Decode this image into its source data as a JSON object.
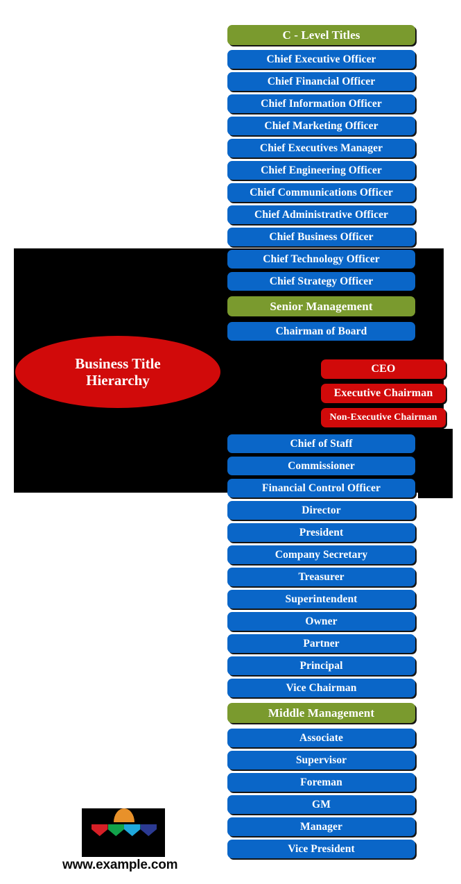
{
  "title": "Business Title Hierarchy",
  "colors": {
    "blue": "#0A66C8",
    "green": "#7A9A2E",
    "red": "#D10A0A",
    "black": "#000000",
    "white": "#FFFFFF"
  },
  "center_node": {
    "line1": "Business Title",
    "line2": "Hierarchy"
  },
  "sections": [
    {
      "header": "C - Level Titles",
      "items": [
        "Chief Executive Officer",
        "Chief Financial Officer",
        "Chief Information Officer",
        "Chief Marketing Officer",
        "Chief Executives Manager",
        "Chief Engineering Officer",
        "Chief Communications Officer",
        "Chief Administrative Officer",
        "Chief Business Officer",
        "Chief Technology Officer",
        "Chief Strategy Officer"
      ]
    },
    {
      "header": "Senior Management",
      "items": [
        "Chairman of Board"
      ]
    },
    {
      "header": "Middle Management",
      "items": [
        "Associate",
        "Supervisor",
        "Foreman",
        "GM",
        "Manager",
        "Vice President"
      ]
    }
  ],
  "red_group": [
    "CEO",
    "Executive Chairman",
    "Non-Executive Chairman"
  ],
  "mid_group": [
    "Chief of Staff",
    "Commissioner",
    "Financial Control Officer",
    "Director",
    "President",
    "Company Secretary",
    "Treasurer",
    "Superintendent",
    "Owner",
    "Partner",
    "Principal",
    "Vice Chairman"
  ],
  "logo": {
    "icon_name": "multicolor-chevron-logo",
    "watermark": "www.example.com"
  }
}
